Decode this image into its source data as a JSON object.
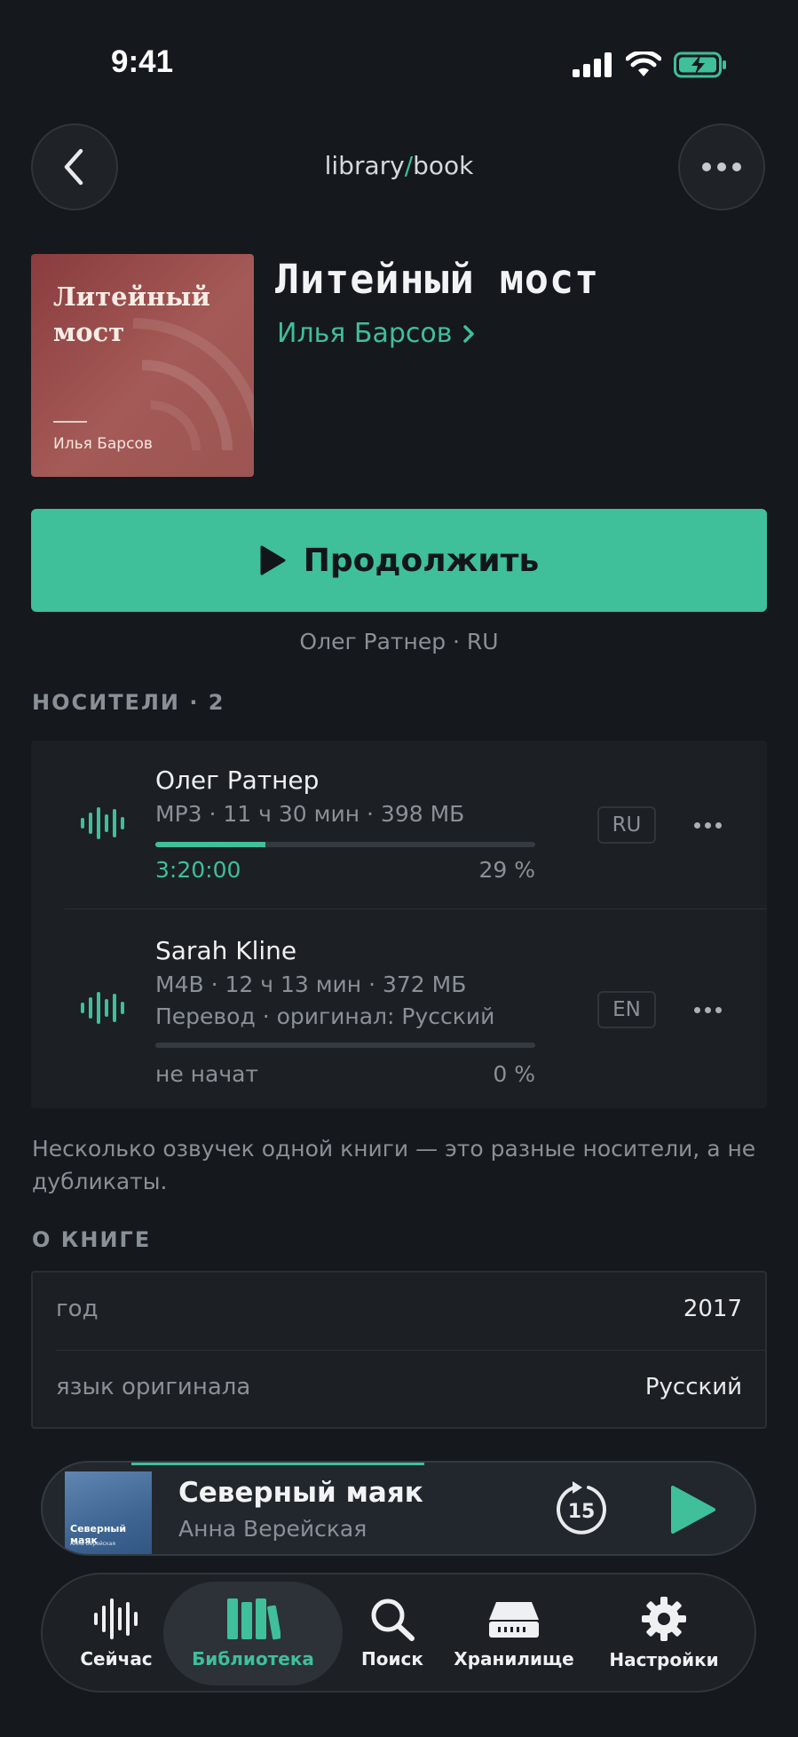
{
  "status_bar": {
    "time": "9:41"
  },
  "header": {
    "path_left": "library",
    "path_sep": "/",
    "path_right": "book",
    "back_icon": "chevron-left-icon",
    "more_icon": "ellipsis-icon"
  },
  "book": {
    "cover_title": "Литейный мост",
    "cover_author": "Илья Барсов",
    "title": "Литейный мост",
    "author": "Илья Барсов"
  },
  "continue_button": {
    "label": "Продолжить",
    "icon": "play-icon"
  },
  "current_narration": "Олег Ратнер · RU",
  "media_section": {
    "title": "НОСИТЕЛИ · 2",
    "items": [
      {
        "narrator": "Олег Ратнер",
        "meta": "MP3 · 11 ч 30 мин · 398 МБ",
        "progress_fraction": 0.29,
        "position": "3:20:00",
        "percent": "29 %",
        "language": "RU"
      },
      {
        "narrator": "Sarah Kline",
        "meta": "M4B · 12 ч 13 мин · 372 МБ",
        "note": "Перевод · оригинал: Русский",
        "progress_fraction": 0,
        "position": "не начат",
        "percent": "0 %",
        "language": "EN"
      }
    ],
    "footnote": "Несколько озвучек одной книги — это разные носители, а не дубликаты."
  },
  "about": {
    "title": "О КНИГЕ",
    "rows": [
      {
        "key": "год",
        "value": "2017"
      },
      {
        "key": "язык оригинала",
        "value": "Русский"
      }
    ]
  },
  "mini_player": {
    "title": "Северный маяк",
    "artist": "Анна Верейская",
    "cover_title": "Северный маяк",
    "cover_sub": "Анна Верейская",
    "skip_label": "15",
    "progress_fraction": 0.41
  },
  "tab_bar": {
    "tabs": [
      {
        "label": "Сейчас",
        "icon": "waveform-icon"
      },
      {
        "label": "Библиотека",
        "icon": "books-icon",
        "active": true
      },
      {
        "label": "Поиск",
        "icon": "search-icon"
      },
      {
        "label": "Хранилище",
        "icon": "storage-drive-icon"
      },
      {
        "label": "Настройки",
        "icon": "gear-icon"
      }
    ]
  },
  "colors": {
    "accent": "#3fbf9a",
    "background": "#15181d",
    "card": "#1c2025"
  }
}
